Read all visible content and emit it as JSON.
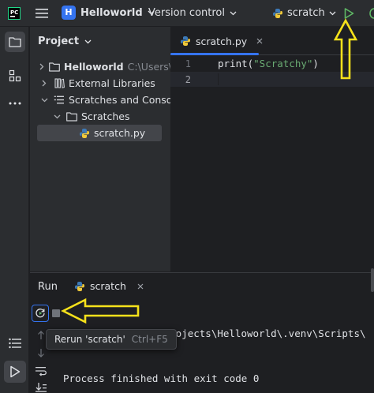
{
  "titlebar": {
    "project_badge": "H",
    "project_name": "Helloworld",
    "vcs_label": "Version control",
    "run_config": "scratch"
  },
  "project_panel": {
    "title": "Project",
    "tree": [
      {
        "label": "Helloworld",
        "detail": "C:\\Users\\ho",
        "icon": "folder-icon",
        "expanded": false
      },
      {
        "label": "External Libraries",
        "icon": "library-icon",
        "expanded": false
      },
      {
        "label": "Scratches and Consoles",
        "icon": "scratches-icon",
        "expanded": true
      },
      {
        "label": "Scratches",
        "icon": "folder-icon",
        "expanded": true
      },
      {
        "label": "scratch.py",
        "icon": "python-file-icon",
        "selected": true
      }
    ]
  },
  "editor": {
    "tab_label": "scratch.py",
    "lines": [
      {
        "num": "1",
        "fn": "print(",
        "str": "\"Scratchy\"",
        "close": ")"
      },
      {
        "num": "2",
        "fn": "",
        "str": "",
        "close": ""
      }
    ]
  },
  "run_panel": {
    "title": "Run",
    "tab_label": "scratch",
    "console_path": "charmProjects\\Helloworld\\.venv\\Scripts\\",
    "console_exit": "Process finished with exit code 0"
  },
  "tooltip": {
    "text": "Rerun 'scratch'",
    "shortcut": "Ctrl+F5"
  },
  "colors": {
    "accent": "#3574f0",
    "run_green": "#5fb865",
    "annotation_arrow": "#f5e11b"
  }
}
